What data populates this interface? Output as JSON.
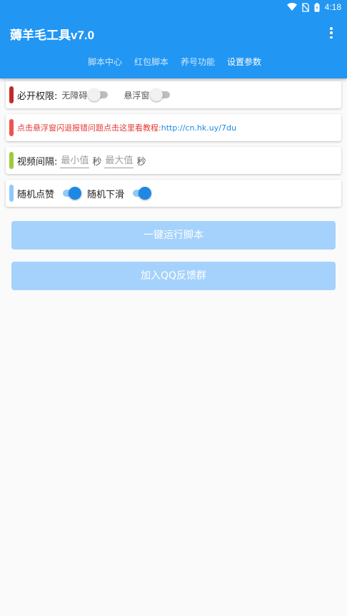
{
  "status_bar": {
    "time": "4:18",
    "icons": [
      "wifi-icon",
      "no-sim-icon",
      "battery-icon"
    ]
  },
  "app_bar": {
    "title": "薅羊毛工具v7.0",
    "menu_icon": "more-vert-icon"
  },
  "tabs": [
    {
      "label": "脚本中心",
      "active": false
    },
    {
      "label": "红包脚本",
      "active": false
    },
    {
      "label": "养号功能",
      "active": false
    },
    {
      "label": "设置参数",
      "active": true
    }
  ],
  "permissions": {
    "label": "必开权限:",
    "accessibility_label": "无障碍",
    "accessibility_on": false,
    "float_label": "悬浮窗",
    "float_on": false
  },
  "tip": {
    "text": "点击悬浮窗闪退报错问题点击这里看教程:",
    "link": "http://cn.hk.uy/7du"
  },
  "video_interval": {
    "label": "视频间隔:",
    "min_placeholder": "最小值",
    "sec_1": "秒",
    "max_placeholder": "最大值",
    "sec_2": "秒"
  },
  "random": {
    "like_label": "随机点赞",
    "like_on": true,
    "swipe_label": "随机下滑",
    "swipe_on": true
  },
  "buttons": {
    "run": "一键运行脚本",
    "join_qq": "加入QQ反馈群"
  },
  "colors": {
    "primary": "#2196f3",
    "accent_red": "#c62828",
    "accent_pink": "#ef5350",
    "accent_green": "#9ccc3d",
    "accent_lightblue": "#90caf9",
    "button_disabled": "#a5d2fc"
  }
}
